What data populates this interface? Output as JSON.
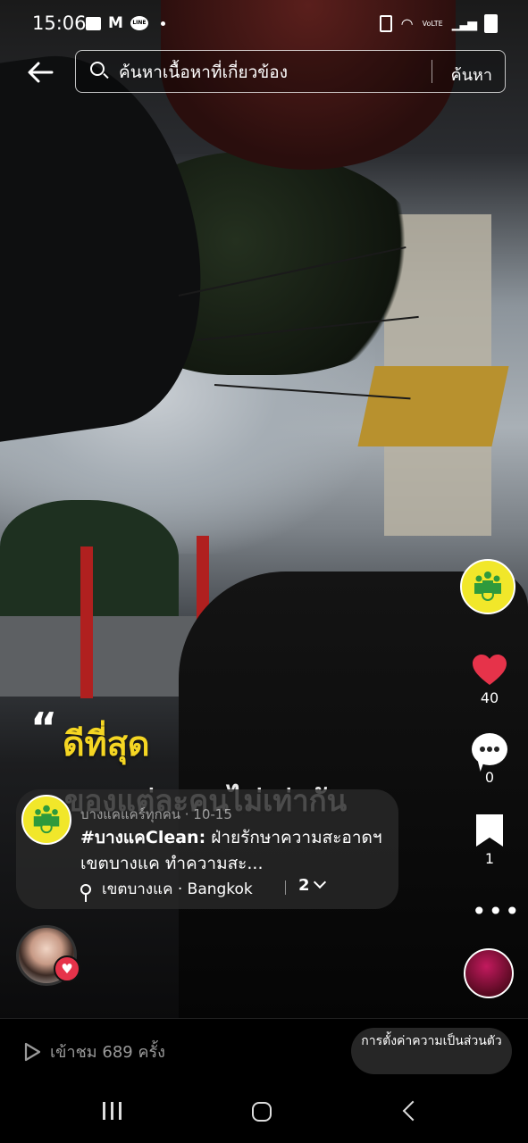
{
  "status_bar": {
    "time": "15:06",
    "notification_icons": [
      "image-icon",
      "gmail-icon",
      "line-icon",
      "dot"
    ],
    "line_label": "LINE",
    "network_label": "VoLTE"
  },
  "search": {
    "placeholder": "ค้นหาเนื้อหาที่เกี่ยวข้อง",
    "button_label": "ค้นหา"
  },
  "video_overlay": {
    "quote_open": "“",
    "line1": "ดีที่สุด",
    "line2": "ของแต่ละคนไม่เท่ากัน"
  },
  "actions": {
    "likes": "40",
    "comments": "0",
    "saves": "1"
  },
  "post": {
    "username": "บางแคแคร์ทุกคน · 10-15",
    "hashtag": "#บางแคClean:",
    "description": " ฝ่ายรักษาความสะอาดฯ เขตบางแค ทำความสะ...",
    "location": "เขตบางแค · Bangkok",
    "location_count": "2"
  },
  "bottom_bar": {
    "views": "เข้าชม 689 ครั้ง",
    "privacy_label": "การตั้งค่าความเป็นส่วนตัว"
  },
  "colors": {
    "heart": "#e6334a",
    "yellow_text": "#f5d623",
    "logo_yellow": "#f1e72a",
    "logo_green": "#2e9a3c"
  }
}
